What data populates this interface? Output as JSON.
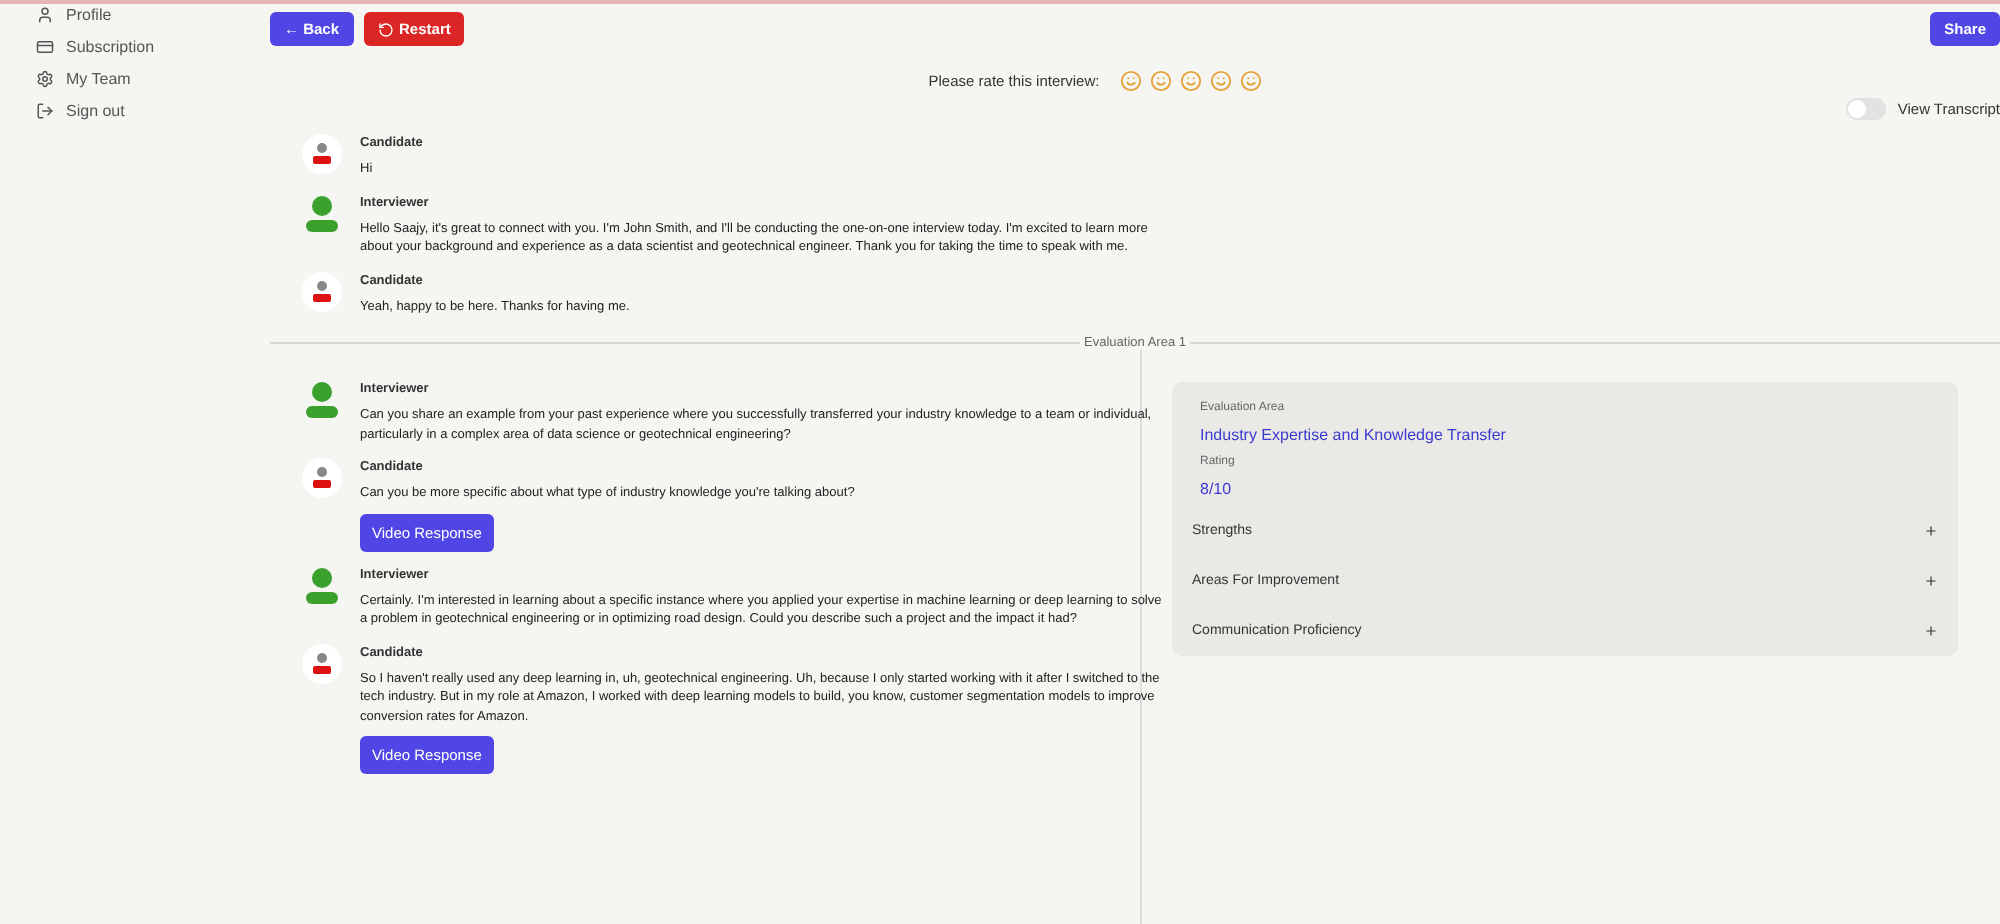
{
  "sidebar": {
    "items": [
      {
        "label": "Profile",
        "kind": "person"
      },
      {
        "label": "Subscription",
        "kind": "card"
      },
      {
        "label": "My Team",
        "kind": "team"
      },
      {
        "label": "Sign out",
        "kind": "signout"
      }
    ]
  },
  "toolbar": {
    "back": "← Back",
    "restart": "Restart",
    "share": "Share"
  },
  "rating": {
    "label": "Please rate this interview:"
  },
  "transcript_toggle": {
    "label": "View Transcript",
    "on": false
  },
  "messages_before": [
    {
      "speaker": "Candidate",
      "kind": "candidate",
      "text": "Hi"
    },
    {
      "speaker": "Interviewer",
      "kind": "interviewer",
      "text": "Hello Saajy, it's great to connect with you. I'm John Smith, and I'll be conducting the one-on-one interview today. I'm excited to learn more about your background and experience as a data scientist and geotechnical engineer. Thank you for taking the time to speak with me."
    },
    {
      "speaker": "Candidate",
      "kind": "candidate",
      "text": "Yeah, happy to be here. Thanks for having me."
    }
  ],
  "section_divider": "Evaluation Area 1",
  "messages": [
    {
      "speaker": "Interviewer",
      "kind": "interviewer",
      "text": "Can you share an example from your past experience where you successfully transferred your industry knowledge to a team or individual, particularly in a complex area of data science or geotechnical engineering?"
    },
    {
      "speaker": "Candidate",
      "kind": "candidate",
      "text": "Can you be more specific about what type of industry knowledge you're talking about?",
      "video_button": "Video Response"
    },
    {
      "speaker": "Interviewer",
      "kind": "interviewer",
      "text": "Certainly. I'm interested in learning about a specific instance where you applied your expertise in machine learning or deep learning to solve a problem in geotechnical engineering or in optimizing road design. Could you describe such a project and the impact it had?"
    },
    {
      "speaker": "Candidate",
      "kind": "candidate",
      "text": "So I haven't really used any deep learning in, uh, geotechnical engineering. Uh, because I only started working with it after I switched to the tech industry. But in my role at Amazon, I worked with deep learning models to build, you know, customer segmentation models to improve conversion rates for Amazon.",
      "video_button": "Video Response"
    }
  ],
  "evaluation": {
    "area_label": "Evaluation Area",
    "area": "Industry Expertise and Knowledge Transfer",
    "rating_label": "Rating",
    "rating": "8/10",
    "sections": [
      {
        "label": "Strengths",
        "expanded": false
      },
      {
        "label": "Areas For Improvement",
        "expanded": false
      },
      {
        "label": "Communication Proficiency",
        "expanded": false
      }
    ]
  }
}
